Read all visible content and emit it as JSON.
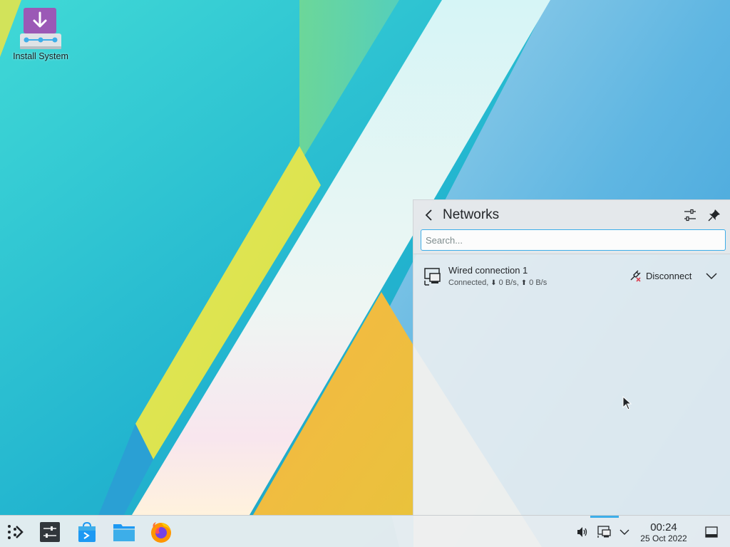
{
  "desktop": {
    "icons": [
      {
        "label": "Install System",
        "icon": "install-system-icon"
      }
    ]
  },
  "network_popup": {
    "title": "Networks",
    "search_placeholder": "Search...",
    "connections": [
      {
        "name": "Wired connection 1",
        "status": "Connected,",
        "download": "0 B/s,",
        "upload": "0 B/s",
        "action_label": "Disconnect"
      }
    ]
  },
  "taskbar": {
    "launchers": [
      "application-launcher-icon",
      "system-settings-icon",
      "discover-icon",
      "file-manager-icon",
      "firefox-icon"
    ],
    "clock": {
      "time": "00:24",
      "date": "25 Oct 2022"
    }
  },
  "colors": {
    "accent": "#3daee9",
    "panel_bg": "#eff0f1",
    "text": "#232629",
    "install_icon": "#9b59b6"
  }
}
